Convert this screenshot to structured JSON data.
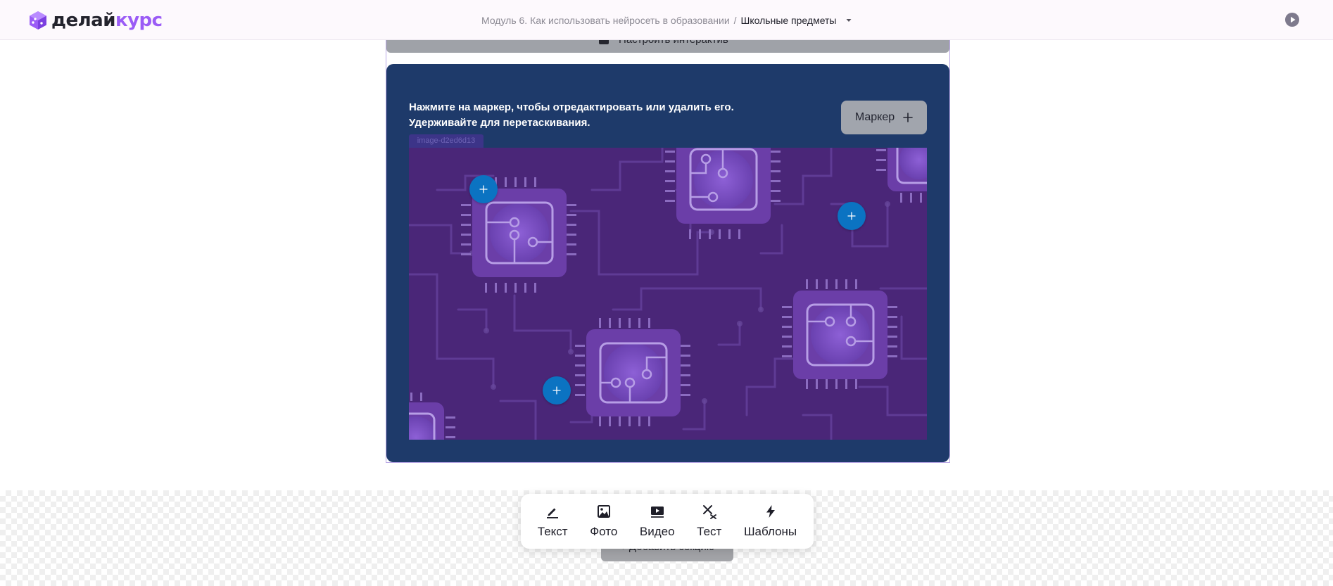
{
  "header": {
    "logo": {
      "part1": "делай",
      "part2": "курс"
    },
    "breadcrumb": {
      "module": "Модуль 6. Как использовать нейросеть в образовании",
      "separator": "/",
      "current": "Школьные предметы"
    }
  },
  "editor": {
    "settings_label": "Настроить интерактив",
    "instructions": [
      "Нажмите на маркер, чтобы отредактировать или удалить его.",
      "Удерживайте для перетаскивания."
    ],
    "marker_button_label": "Маркер",
    "image_tag": "image-d2ed6d13",
    "markers_count": 3
  },
  "toolbar": {
    "items": [
      {
        "label": "Текст",
        "icon": "pencil-icon"
      },
      {
        "label": "Фото",
        "icon": "image-icon"
      },
      {
        "label": "Видео",
        "icon": "video-icon"
      },
      {
        "label": "Тест",
        "icon": "test-icon"
      },
      {
        "label": "Шаблоны",
        "icon": "lightning-icon"
      }
    ]
  },
  "add_section_label": "+ Добавить секцию",
  "colors": {
    "brand_purple": "#9b5cf6",
    "card_blue": "#1e3a6a",
    "marker_blue": "#0b73c2",
    "image_purple": "#4a2678"
  }
}
